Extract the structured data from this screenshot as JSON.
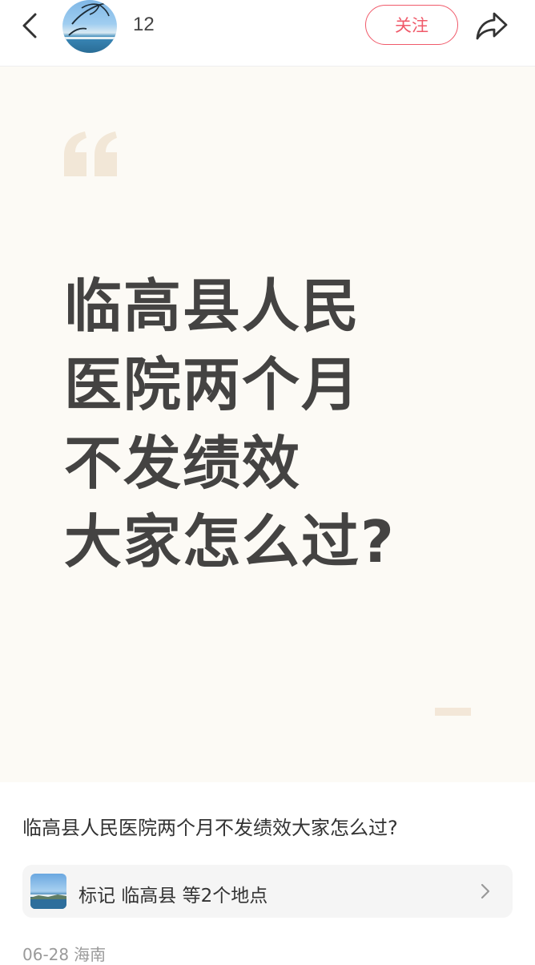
{
  "header": {
    "username": "12",
    "follow_label": "关注",
    "icons": {
      "back": "back-arrow-icon",
      "share": "share-arrow-icon"
    }
  },
  "cover": {
    "lines": [
      "临高县人民",
      "医院两个月",
      "不发绩效",
      "大家怎么过?"
    ],
    "colors": {
      "background": "#fcfaf5",
      "text": "#444342",
      "accent": "#f3e7d8"
    }
  },
  "post": {
    "title": "临高县人民医院两个月不发绩效大家怎么过?"
  },
  "location": {
    "text": "标记 临高县 等2个地点"
  },
  "meta": {
    "date": "06-28",
    "region": "海南"
  },
  "colors": {
    "accent": "#f05a6a"
  }
}
